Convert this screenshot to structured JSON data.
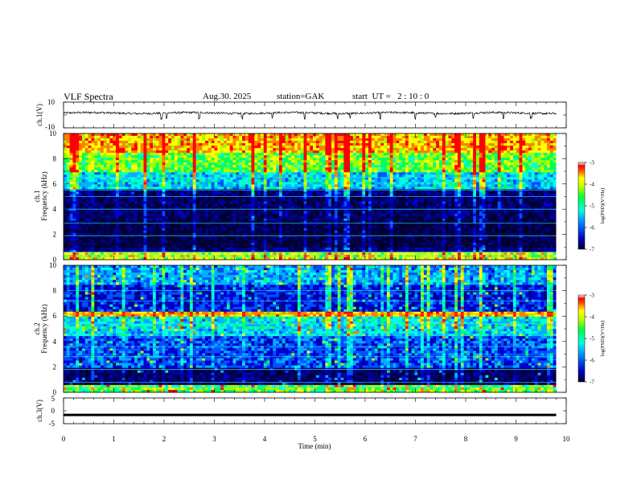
{
  "header": {
    "title": "VLF Spectra",
    "date": "Aug.30. 2025",
    "station": "station=GAK",
    "start_ut": "start  UT =   2 : 10 : 0"
  },
  "chart_data": [
    {
      "id": "ch1-waveform",
      "type": "line",
      "ylabel": "ch.1(V)",
      "ylim": [
        -10,
        10
      ],
      "y_ticks": [
        "10",
        "-10"
      ],
      "xlim": [
        0,
        10
      ],
      "baseline": 1.5,
      "noise_amplitude": 0.8,
      "spike_times": [
        1.95,
        2.05,
        2.7,
        3.55,
        4.15,
        4.8,
        5.45,
        5.7,
        6.3,
        7.0,
        7.4,
        8.15,
        8.75,
        9.3
      ],
      "color": "#000000"
    },
    {
      "id": "ch1-spectrogram",
      "type": "heatmap",
      "ylabel": "ch.1\nFrequency (kHz)",
      "y_ticks": [
        "0",
        "2",
        "4",
        "6",
        "8",
        "10"
      ],
      "ylim": [
        0,
        10
      ],
      "xlim": [
        0,
        10
      ],
      "band_profile": [
        {
          "f_from": 0.0,
          "f_to": 0.5,
          "level": -4.2
        },
        {
          "f_from": 0.5,
          "f_to": 1.0,
          "level": -6.6
        },
        {
          "f_from": 1.0,
          "f_to": 3.0,
          "level": -6.9
        },
        {
          "f_from": 3.0,
          "f_to": 5.5,
          "level": -6.7
        },
        {
          "f_from": 5.5,
          "f_to": 7.0,
          "level": -5.4
        },
        {
          "f_from": 7.0,
          "f_to": 8.5,
          "level": -4.6
        },
        {
          "f_from": 8.5,
          "f_to": 10.0,
          "level": -3.9
        }
      ],
      "colorbar": {
        "label": "log(PSD)(V²/Hz)",
        "ticks": [
          "-3",
          "-4",
          "-5",
          "-6",
          "-7"
        ],
        "range": [
          -7,
          -3
        ]
      }
    },
    {
      "id": "ch2-spectrogram",
      "type": "heatmap",
      "ylabel": "ch.2\nFrequency (kHz)",
      "y_ticks": [
        "0",
        "2",
        "4",
        "6",
        "8",
        "10"
      ],
      "ylim": [
        0,
        10
      ],
      "xlim": [
        0,
        10
      ],
      "band_profile": [
        {
          "f_from": 0.0,
          "f_to": 0.5,
          "level": -4.6
        },
        {
          "f_from": 0.5,
          "f_to": 2.0,
          "level": -6.7
        },
        {
          "f_from": 2.0,
          "f_to": 4.5,
          "level": -5.9
        },
        {
          "f_from": 4.5,
          "f_to": 6.0,
          "level": -5.3
        },
        {
          "f_from": 6.0,
          "f_to": 6.3,
          "level": -4.0
        },
        {
          "f_from": 6.3,
          "f_to": 8.5,
          "level": -6.2
        },
        {
          "f_from": 8.5,
          "f_to": 10.0,
          "level": -5.6
        }
      ],
      "colorbar": {
        "label": "log(PSD)(V²/Hz)",
        "ticks": [
          "-3",
          "-4",
          "-5",
          "-6",
          "-7"
        ],
        "range": [
          -7,
          -3
        ]
      }
    },
    {
      "id": "ch3-waveform",
      "type": "line",
      "ylabel": "ch.3(V)",
      "ylim": [
        -5,
        5
      ],
      "y_ticks": [
        "5",
        "0",
        "-5"
      ],
      "xlim": [
        0,
        10
      ],
      "baseline": -1.6,
      "color": "#000000"
    }
  ],
  "x_axis": {
    "label": "Time  (min)",
    "ticks": [
      "0",
      "1",
      "2",
      "3",
      "4",
      "5",
      "6",
      "7",
      "8",
      "9",
      "10"
    ],
    "range": [
      0,
      10
    ]
  },
  "colors": {
    "colormap": [
      "#000033",
      "#000080",
      "#0000d0",
      "#0050ff",
      "#00b0ff",
      "#00ffe0",
      "#00ff60",
      "#a0ff00",
      "#ffff00",
      "#ff8000",
      "#ff0000",
      "#ffffff"
    ],
    "axis": "#000000",
    "background": "#ffffff"
  }
}
